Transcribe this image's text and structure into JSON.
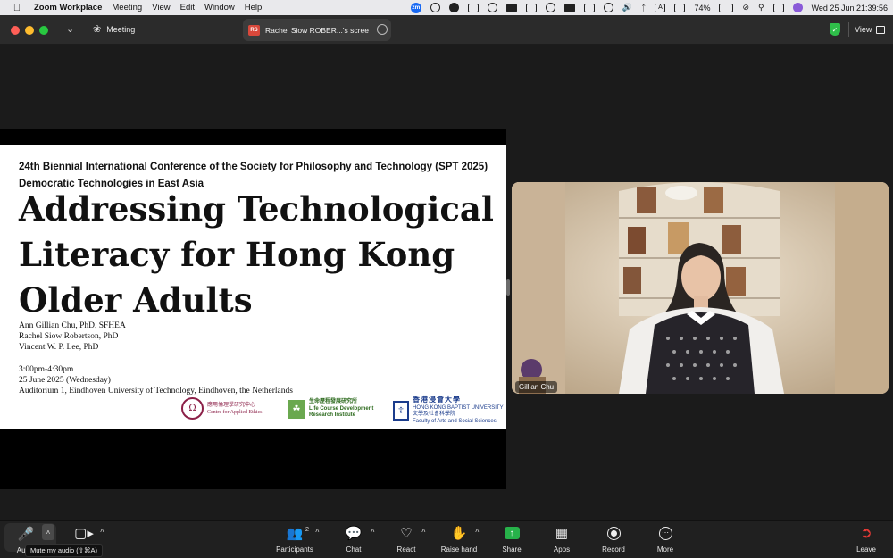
{
  "menubar": {
    "app_name": "Zoom Workplace",
    "items": [
      "Meeting",
      "View",
      "Edit",
      "Window",
      "Help"
    ],
    "battery": "74%",
    "input_indicator": "A",
    "datetime": "Wed 25 Jun  21:39:56"
  },
  "titlebar": {
    "meeting_tab": "Meeting",
    "share_tab_initials": "RS",
    "share_tab_title": "Rachel Siow ROBER...'s scree",
    "view_label": "View"
  },
  "slide": {
    "conference_line1": "24th Biennial International Conference of the Society for Philosophy and Technology (SPT 2025)",
    "conference_line2": "Democratic Technologies in East Asia",
    "title_line1": "Addressing Technological",
    "title_line2": "Literacy for Hong Kong",
    "title_line3": "Older Adults",
    "author1": "Ann Gillian Chu, PhD, SFHEA",
    "author2": "Rachel Siow Robertson, PhD",
    "author3": "Vincent W. P. Lee, PhD",
    "time": "3:00pm-4:30pm",
    "date": "25 June 2025 (Wednesday)",
    "venue": "Auditorium 1, Eindhoven University of Technology, Eindhoven, the Netherlands",
    "logo1_zh": "應用倫理學研究中心",
    "logo1_en": "Centre for Applied Ethics",
    "logo2_zh": "生命歷程發展研究所",
    "logo2_en1": "Life Course Development",
    "logo2_en2": "Research Institute",
    "logo3_zh": "香港浸會大學",
    "logo3_en": "HONG KONG BAPTIST UNIVERSITY",
    "logo3_sub_zh": "文學及社會科學院",
    "logo3_sub_en": "Faculty of Arts and Social Sciences"
  },
  "video": {
    "participant_name": "Gillian Chu"
  },
  "toolbar": {
    "audio_label": "Audio",
    "tooltip": "Mute my audio (⇧⌘A)",
    "participants_label": "Participants",
    "participants_count": "2",
    "chat_label": "Chat",
    "react_label": "React",
    "raise_hand_label": "Raise hand",
    "share_label": "Share",
    "apps_label": "Apps",
    "record_label": "Record",
    "more_label": "More",
    "leave_label": "Leave"
  },
  "colors": {
    "share_green": "#27b24a",
    "leave_red": "#e53935",
    "zoom_blue": "#1768f3"
  }
}
